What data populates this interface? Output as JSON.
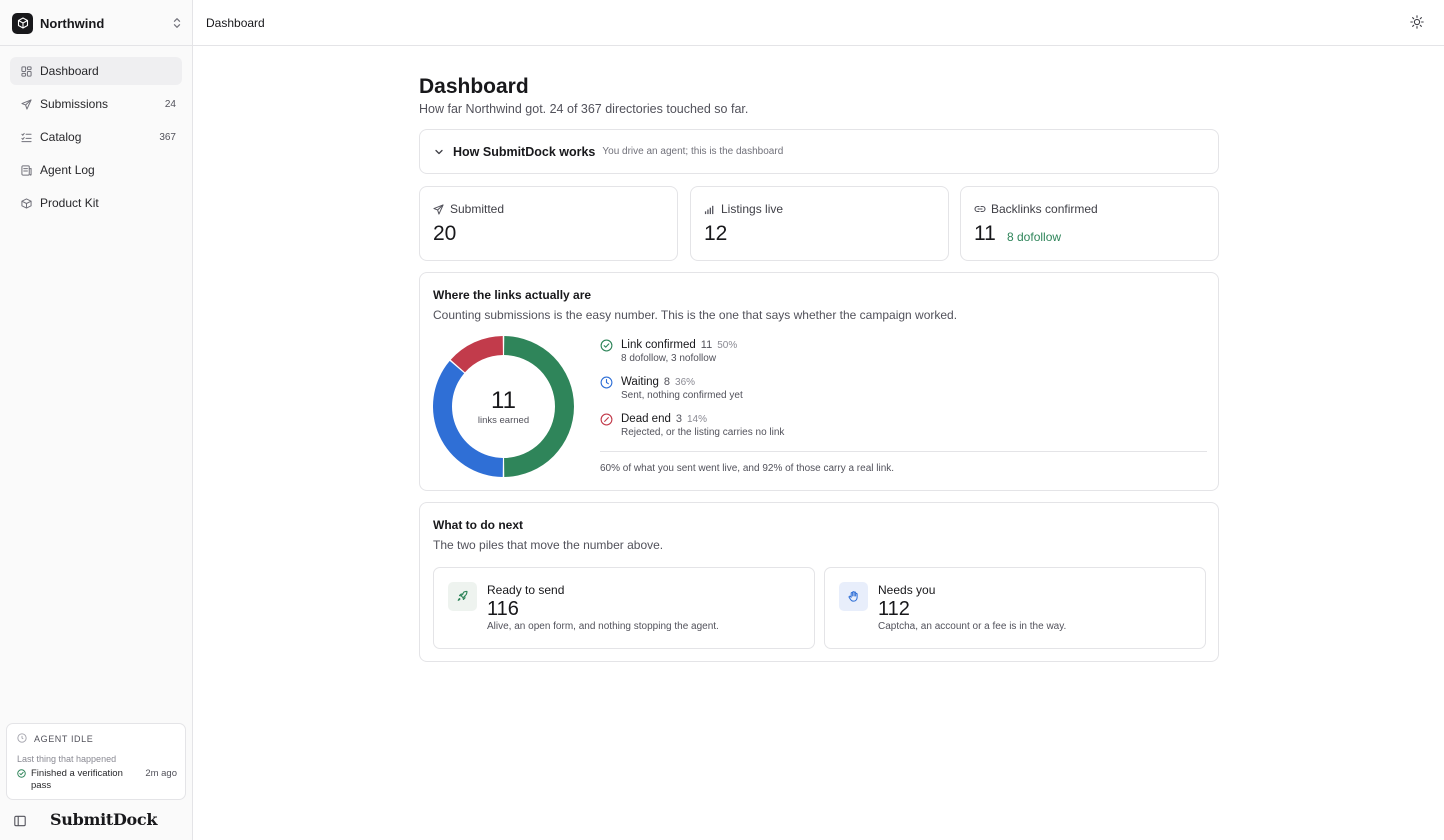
{
  "sidebar": {
    "org_name": "Northwind",
    "nav": [
      {
        "label": "Dashboard",
        "count": ""
      },
      {
        "label": "Submissions",
        "count": "24"
      },
      {
        "label": "Catalog",
        "count": "367"
      },
      {
        "label": "Agent Log",
        "count": ""
      },
      {
        "label": "Product Kit",
        "count": ""
      }
    ],
    "agent": {
      "status": "AGENT IDLE",
      "last_label": "Last thing that happened",
      "event": "Finished a verification pass",
      "time": "2m ago"
    },
    "brand": "SubmitDock"
  },
  "topbar": {
    "breadcrumb": "Dashboard"
  },
  "main": {
    "title": "Dashboard",
    "subtitle": "How far Northwind got. 24 of 367 directories touched so far.",
    "how": {
      "title": "How SubmitDock works",
      "subtitle": "You drive an agent; this is the dashboard"
    },
    "stats": [
      {
        "label": "Submitted",
        "value": "20",
        "extra": ""
      },
      {
        "label": "Listings live",
        "value": "12",
        "extra": ""
      },
      {
        "label": "Backlinks confirmed",
        "value": "11",
        "extra": "8 dofollow"
      }
    ],
    "links": {
      "title": "Where the links actually are",
      "subtitle": "Counting submissions is the easy number. This is the one that says whether the campaign worked.",
      "center_value": "11",
      "center_label": "links earned",
      "items": [
        {
          "title": "Link confirmed",
          "count": "11",
          "pct": "50%",
          "desc": "8 dofollow, 3 nofollow"
        },
        {
          "title": "Waiting",
          "count": "8",
          "pct": "36%",
          "desc": "Sent, nothing confirmed yet"
        },
        {
          "title": "Dead end",
          "count": "3",
          "pct": "14%",
          "desc": "Rejected, or the listing carries no link"
        }
      ],
      "footer": "60% of what you sent went live, and 92% of those carry a real link."
    },
    "next": {
      "title": "What to do next",
      "subtitle": "The two piles that move the number above.",
      "piles": [
        {
          "label": "Ready to send",
          "value": "116",
          "desc": "Alive, an open form, and nothing stopping the agent."
        },
        {
          "label": "Needs you",
          "value": "112",
          "desc": "Captcha, an account or a fee is in the way."
        }
      ]
    }
  },
  "colors": {
    "confirmed": "#2f855a",
    "waiting": "#2f6fd6",
    "dead": "#c23b4b",
    "accent_green_bg": "#eef3ef",
    "accent_blue_bg": "#e8eefb"
  },
  "chart_data": {
    "type": "pie",
    "categories": [
      "Link confirmed",
      "Waiting",
      "Dead end"
    ],
    "values": [
      11,
      8,
      3
    ]
  }
}
